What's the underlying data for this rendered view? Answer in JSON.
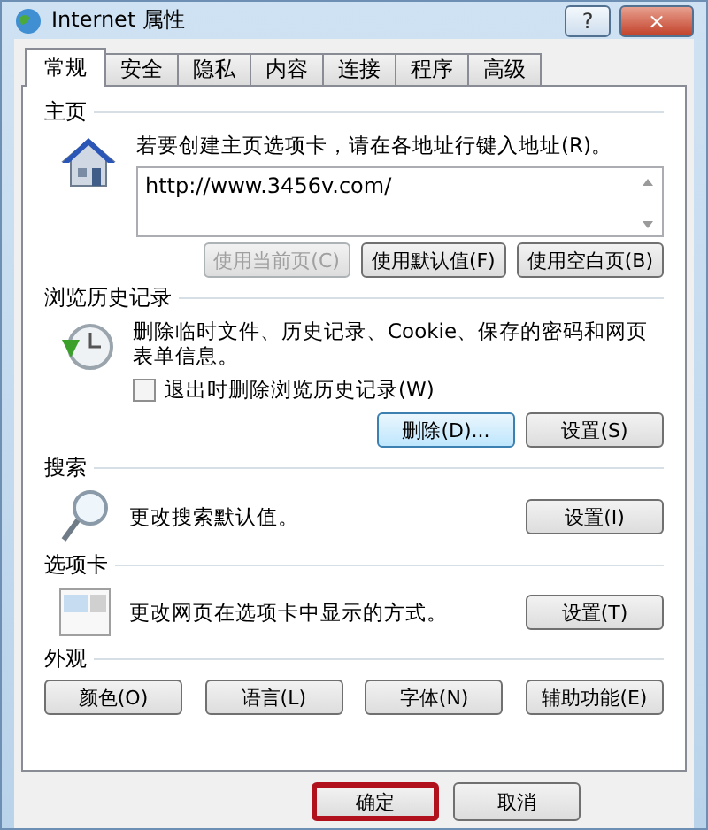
{
  "window": {
    "title": "Internet 属性",
    "buttons": [
      "?",
      "×"
    ]
  },
  "tabs": [
    {
      "label": "常规",
      "selected": true
    },
    {
      "label": "安全",
      "selected": false
    },
    {
      "label": "隐私",
      "selected": false
    },
    {
      "label": "内容",
      "selected": false
    },
    {
      "label": "连接",
      "selected": false
    },
    {
      "label": "程序",
      "selected": false
    },
    {
      "label": "高级",
      "selected": false
    }
  ],
  "sections": [
    {
      "kind": "homepage",
      "label": "主页",
      "prompt": "若要创建主页选项卡，请在各地址行键入地址(R)。",
      "url": "http://www.3456v.com/",
      "buttons": [
        {
          "label": "使用当前页(C)",
          "disabled": true,
          "focused": false
        },
        {
          "label": "使用默认值(F)",
          "disabled": false,
          "focused": false
        },
        {
          "label": "使用空白页(B)",
          "disabled": false,
          "focused": false
        }
      ]
    },
    {
      "kind": "history",
      "label": "浏览历史记录",
      "description": "删除临时文件、历史记录、Cookie、保存的密码和网页表单信息。",
      "checkbox": {
        "label": "退出时删除浏览历史记录(W)",
        "checked": false
      },
      "buttons": [
        {
          "label": "删除(D)...",
          "disabled": false,
          "focused": true
        },
        {
          "label": "设置(S)",
          "disabled": false,
          "focused": false
        }
      ]
    },
    {
      "kind": "search",
      "label": "搜索",
      "description": "更改搜索默认值。",
      "buttons": [
        {
          "label": "设置(I)",
          "disabled": false,
          "focused": false
        }
      ]
    },
    {
      "kind": "tabs",
      "label": "选项卡",
      "description": "更改网页在选项卡中显示的方式。",
      "buttons": [
        {
          "label": "设置(T)",
          "disabled": false,
          "focused": false
        }
      ]
    },
    {
      "kind": "appearance",
      "label": "外观",
      "buttons": [
        {
          "label": "颜色(O)",
          "disabled": false,
          "focused": false
        },
        {
          "label": "语言(L)",
          "disabled": false,
          "focused": false
        },
        {
          "label": "字体(N)",
          "disabled": false,
          "focused": false
        },
        {
          "label": "辅助功能(E)",
          "disabled": false,
          "focused": false
        }
      ]
    }
  ],
  "footer": {
    "buttons": [
      {
        "label": "确定",
        "highlighted": true
      },
      {
        "label": "取消",
        "highlighted": false
      }
    ]
  }
}
